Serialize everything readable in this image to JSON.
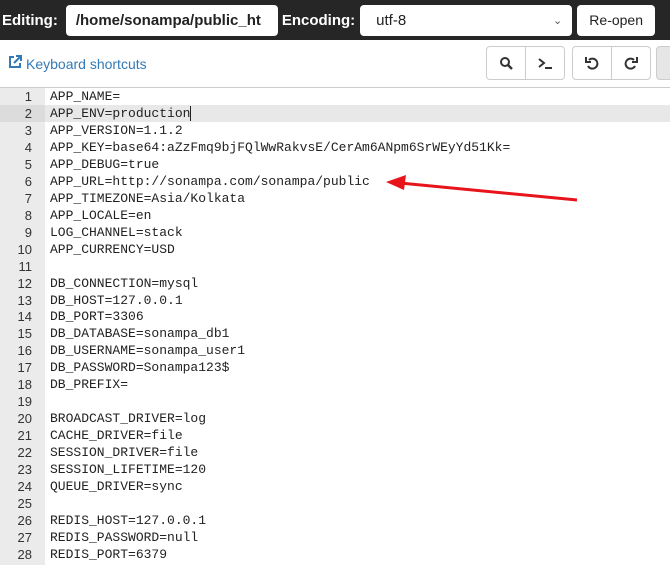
{
  "topbar": {
    "editing_label": "Editing:",
    "path_value": "/home/sonampa/public_ht",
    "encoding_label": "Encoding:",
    "encoding_value": "utf-8",
    "reopen_label": "Re-open"
  },
  "toolbar": {
    "keyboard_shortcuts": "Keyboard shortcuts",
    "icons": [
      "search-icon",
      "terminal-icon",
      "undo-icon",
      "redo-icon"
    ]
  },
  "editor": {
    "active_line": 2,
    "lines": [
      "APP_NAME=",
      "APP_ENV=production",
      "APP_VERSION=1.1.2",
      "APP_KEY=base64:aZzFmq9bjFQlWwRakvsE/CerAm6ANpm6SrWEyYd51Kk=",
      "APP_DEBUG=true",
      "APP_URL=http://sonampa.com/sonampa/public",
      "APP_TIMEZONE=Asia/Kolkata",
      "APP_LOCALE=en",
      "LOG_CHANNEL=stack",
      "APP_CURRENCY=USD",
      "",
      "DB_CONNECTION=mysql",
      "DB_HOST=127.0.0.1",
      "DB_PORT=3306",
      "DB_DATABASE=sonampa_db1",
      "DB_USERNAME=sonampa_user1",
      "DB_PASSWORD=Sonampa123$",
      "DB_PREFIX=",
      "",
      "BROADCAST_DRIVER=log",
      "CACHE_DRIVER=file",
      "SESSION_DRIVER=file",
      "SESSION_LIFETIME=120",
      "QUEUE_DRIVER=sync",
      "",
      "REDIS_HOST=127.0.0.1",
      "REDIS_PASSWORD=null",
      "REDIS_PORT=6379"
    ]
  },
  "annotation": {
    "color": "#e8141b",
    "points_to_line": 6
  }
}
